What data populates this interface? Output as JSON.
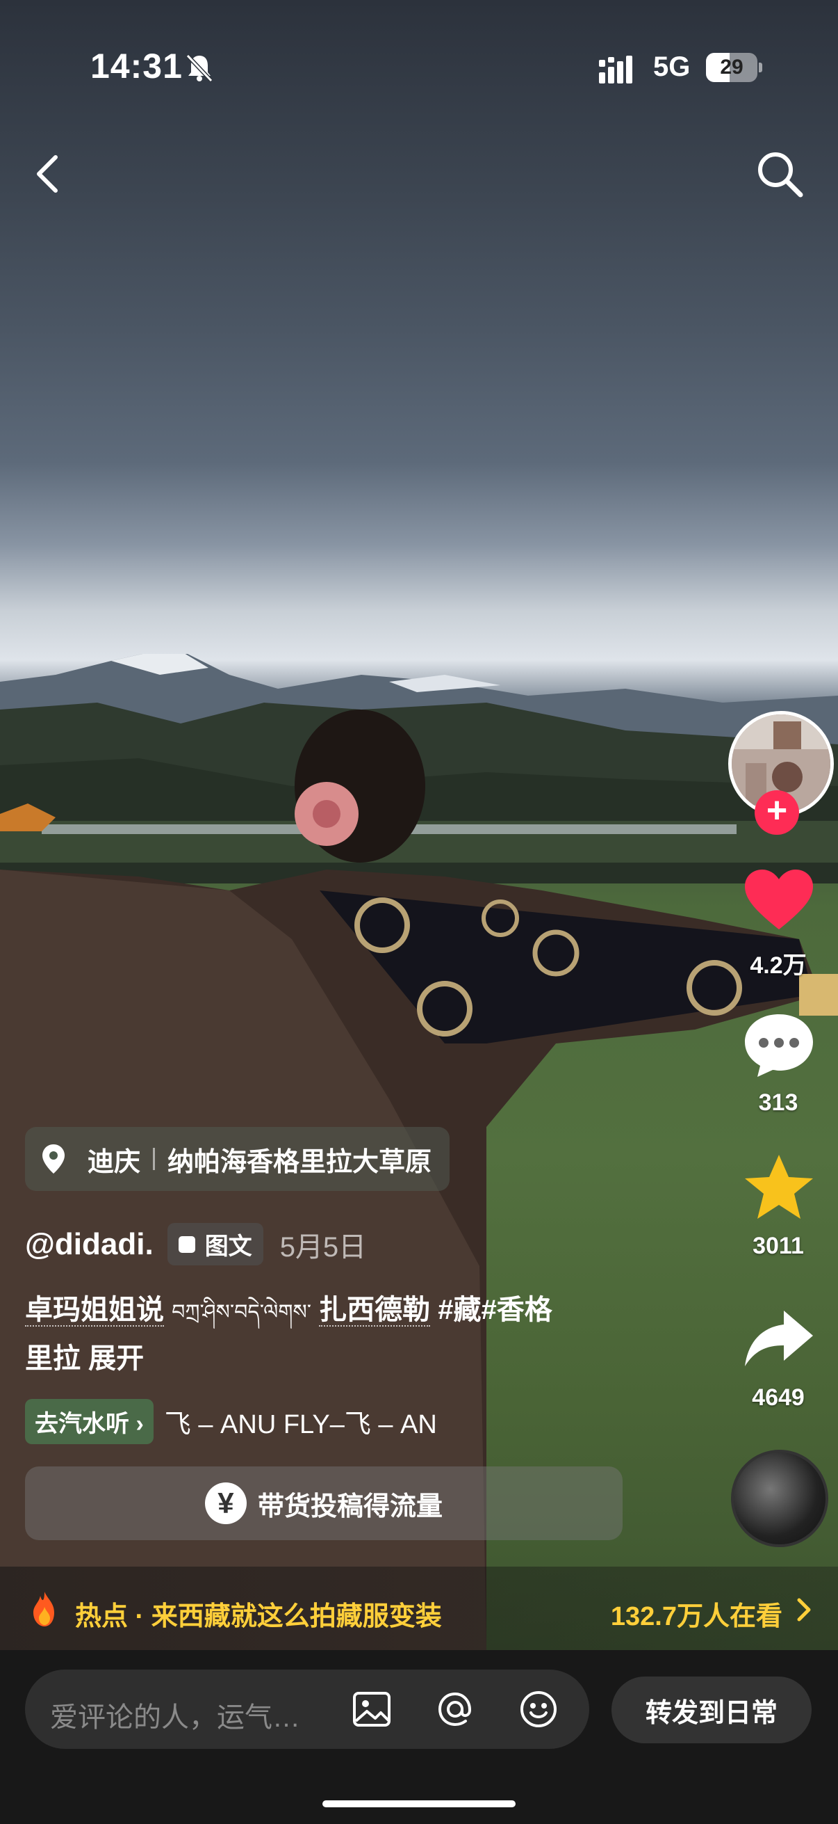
{
  "status_bar": {
    "time": "14:31",
    "network": "5G",
    "battery": "29"
  },
  "post": {
    "location_city": "迪庆",
    "location_place": "纳帕海香格里拉大草原",
    "author": "@didadi.",
    "type_tag": "图文",
    "date": "5月5日",
    "desc_line1_a": "卓玛姐姐说",
    "desc_line1_b": "བཀྲ་ཤིས་བདེ་ལེགས་",
    "desc_line1_c": "扎西德勒",
    "desc_line1_d": "#藏#香格",
    "desc_line2": "里拉",
    "expand": "展开",
    "music_chip": "去汽水听",
    "music_title": "飞 – ANU    FLY–飞 – AN",
    "promo": "带货投稿得流量"
  },
  "actions": {
    "likes": "4.2万",
    "comments": "313",
    "favorites": "3011",
    "shares": "4649"
  },
  "hot_bar": {
    "label": "热点 · 来西藏就这么拍藏服变装",
    "viewers": "132.7万人在看"
  },
  "comment_bar": {
    "placeholder": "爱评论的人，运气…",
    "share_daily": "转发到日常"
  },
  "colors": {
    "like": "#fe2c55",
    "favorite": "#f8c21c",
    "hot": "#ffcf3a"
  }
}
